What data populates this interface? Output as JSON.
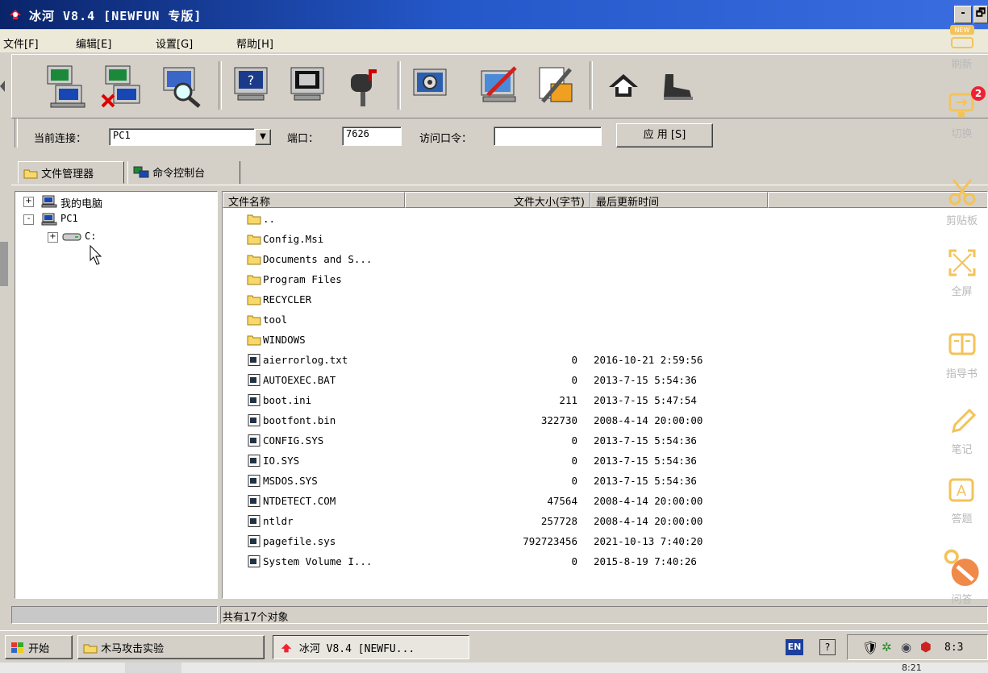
{
  "window": {
    "title": "冰河 V8.4 [NEWFUN 专版]",
    "controls": [
      "-",
      "🗗"
    ]
  },
  "menu": [
    "文件[F]",
    "编辑[E]",
    "设置[G]",
    "帮助[H]"
  ],
  "toolbar": {
    "icons": [
      "add-computer-icon",
      "delete-computer-icon",
      "search-computer-icon",
      "help-monitor-icon",
      "screen-capture-icon",
      "mailbox-icon",
      "settings-gear-icon",
      "system-edit-icon",
      "config-tool-icon",
      "home-arrow-icon",
      "boot-icon"
    ]
  },
  "connection": {
    "current_label": "当前连接：",
    "current_value": "PC1",
    "port_label": "端口：",
    "port_value": "7626",
    "password_label": "访问口令：",
    "password_value": "",
    "apply_label": "应 用 [S]"
  },
  "tabs": [
    "文件管理器",
    "命令控制台"
  ],
  "tree": {
    "items": [
      {
        "expander": "+",
        "label": "我的电脑"
      },
      {
        "expander": "-",
        "label": "PC1"
      },
      {
        "expander": "+",
        "label": "C:"
      }
    ]
  },
  "list": {
    "columns": [
      "文件名称",
      "文件大小(字节)",
      "最后更新时间"
    ],
    "folders": [
      "..",
      "Config.Msi",
      "Documents and S...",
      "Program Files",
      "RECYCLER",
      "tool",
      "WINDOWS"
    ],
    "files": [
      {
        "name": "aierrorlog.txt",
        "size": "0",
        "time": "2016-10-21 2:59:56"
      },
      {
        "name": "AUTOEXEC.BAT",
        "size": "0",
        "time": "2013-7-15 5:54:36"
      },
      {
        "name": "boot.ini",
        "size": "211",
        "time": "2013-7-15 5:47:54"
      },
      {
        "name": "bootfont.bin",
        "size": "322730",
        "time": "2008-4-14 20:00:00"
      },
      {
        "name": "CONFIG.SYS",
        "size": "0",
        "time": "2013-7-15 5:54:36"
      },
      {
        "name": "IO.SYS",
        "size": "0",
        "time": "2013-7-15 5:54:36"
      },
      {
        "name": "MSDOS.SYS",
        "size": "0",
        "time": "2013-7-15 5:54:36"
      },
      {
        "name": "NTDETECT.COM",
        "size": "47564",
        "time": "2008-4-14 20:00:00"
      },
      {
        "name": "ntldr",
        "size": "257728",
        "time": "2008-4-14 20:00:00"
      },
      {
        "name": "pagefile.sys",
        "size": "792723456",
        "time": "2021-10-13 7:40:20"
      },
      {
        "name": "System Volume I...",
        "size": "0",
        "time": "2015-8-19 7:40:26"
      }
    ]
  },
  "status": {
    "text": "共有17个对象"
  },
  "taskbar": {
    "start": "开始",
    "tasks": [
      "木马攻击实验",
      "冰河 V8.4 [NEWFU..."
    ],
    "lang": "EN",
    "clock": "8:3"
  },
  "sidebar": {
    "badge": "2",
    "items": [
      "刷新",
      "切换",
      "剪贴板",
      "全屏",
      "指导书",
      "笔记",
      "答题",
      "问答"
    ]
  },
  "bottom": {
    "clock": "8:21"
  }
}
